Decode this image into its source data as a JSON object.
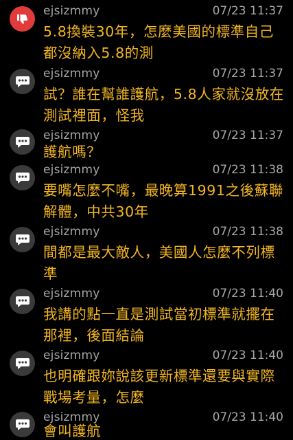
{
  "comments": [
    {
      "user": "ejsizmmy",
      "time": "07/23 11:37",
      "type": "thumbs-down",
      "avatar_color": "#e13c3c",
      "text": "5.8換裝30年，怎麼美國的標準自己都沒納入5.8的測"
    },
    {
      "user": "ejsizmmy",
      "time": "07/23 11:37",
      "type": "comment",
      "avatar_color": "#3a3a3a",
      "text": "試？誰在幫誰護航，5.8人家就沒放在測試裡面，怪我"
    },
    {
      "user": "ejsizmmy",
      "time": "07/23 11:37",
      "type": "comment",
      "avatar_color": "#3a3a3a",
      "text": "護航嗎？"
    },
    {
      "user": "ejsizmmy",
      "time": "07/23 11:38",
      "type": "comment",
      "avatar_color": "#3a3a3a",
      "text": "要嘴怎麼不嘴，最晚算1991之後蘇聯解體，中共30年"
    },
    {
      "user": "ejsizmmy",
      "time": "07/23 11:38",
      "type": "comment",
      "avatar_color": "#3a3a3a",
      "text": "間都是最大敵人，美國人怎麼不列標準"
    },
    {
      "user": "ejsizmmy",
      "time": "07/23 11:40",
      "type": "comment",
      "avatar_color": "#3a3a3a",
      "text": "我講的點一直是測試當初標準就擺在那裡，後面結論"
    },
    {
      "user": "ejsizmmy",
      "time": "07/23 11:40",
      "type": "comment",
      "avatar_color": "#3a3a3a",
      "text": "也明確跟妳說該更新標準還要與實際戰場考量，怎麼"
    },
    {
      "user": "ejsizmmy",
      "time": "07/23 11:40",
      "type": "comment",
      "avatar_color": "#3a3a3a",
      "text": "會叫護航"
    }
  ]
}
